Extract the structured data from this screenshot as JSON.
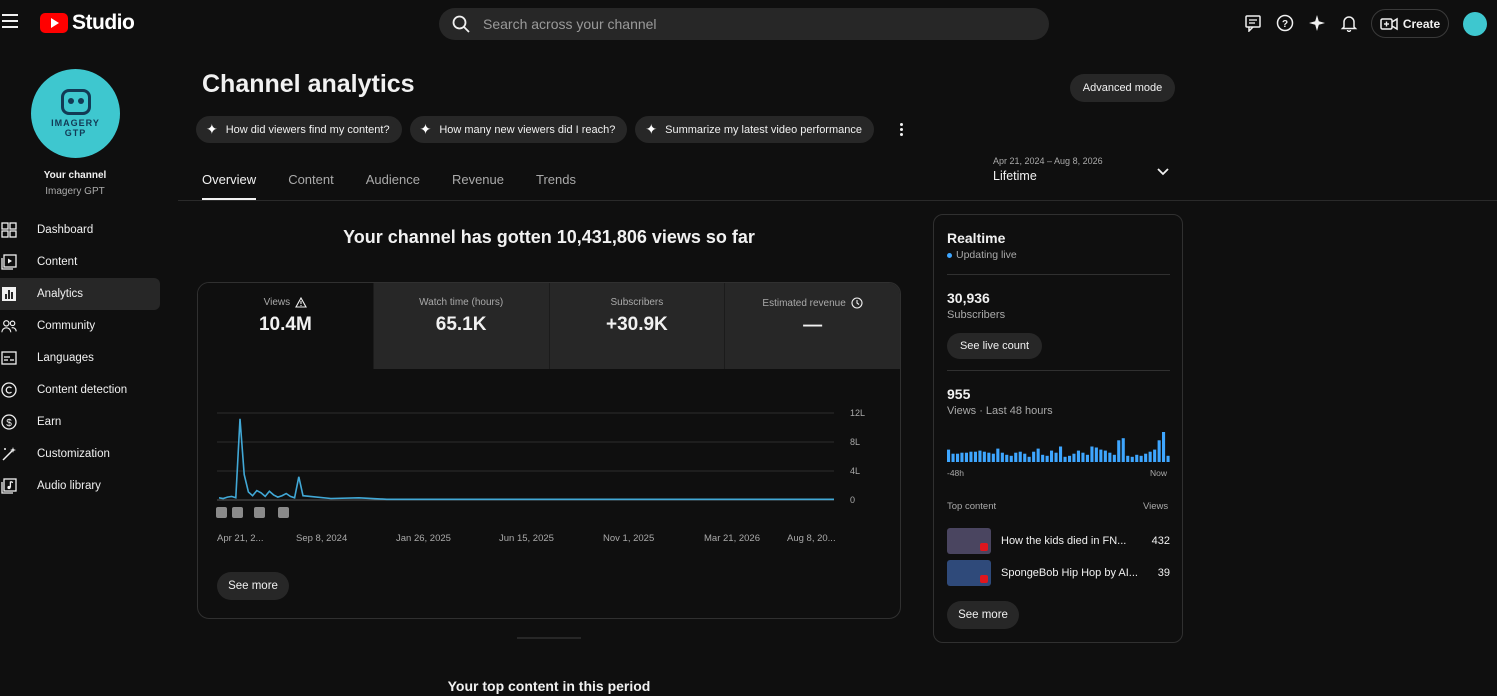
{
  "app": {
    "name": "Studio",
    "brand_color": "#ff0000",
    "accent": "#3ea6ff"
  },
  "search": {
    "placeholder": "Search across your channel"
  },
  "topbar": {
    "icons": [
      "feedback-icon",
      "help-icon",
      "sparkle-icon",
      "bell-icon"
    ],
    "create_label": "Create"
  },
  "channel": {
    "avatar_text_line1": "IMAGERY",
    "avatar_text_line2": "GTP",
    "label": "Your channel",
    "name": "Imagery GPT"
  },
  "sidebar": {
    "items": [
      {
        "label": "Dashboard",
        "icon": "dashboard-icon",
        "active": false
      },
      {
        "label": "Content",
        "icon": "content-icon",
        "active": false
      },
      {
        "label": "Analytics",
        "icon": "analytics-icon",
        "active": true
      },
      {
        "label": "Community",
        "icon": "community-icon",
        "active": false
      },
      {
        "label": "Languages",
        "icon": "languages-icon",
        "active": false
      },
      {
        "label": "Content detection",
        "icon": "copyright-icon",
        "active": false
      },
      {
        "label": "Earn",
        "icon": "earn-icon",
        "active": false
      },
      {
        "label": "Customization",
        "icon": "customization-icon",
        "active": false
      },
      {
        "label": "Audio library",
        "icon": "audio-library-icon",
        "active": false
      }
    ]
  },
  "page": {
    "title": "Channel analytics",
    "advanced_mode": "Advanced mode",
    "chips": [
      "How did viewers find my content?",
      "How many new viewers did I reach?",
      "Summarize my latest video performance"
    ],
    "tabs": [
      "Overview",
      "Content",
      "Audience",
      "Revenue",
      "Trends"
    ],
    "active_tab": "Overview",
    "date_range": {
      "range": "Apr 21, 2024 – Aug 8, 2026",
      "label": "Lifetime"
    }
  },
  "overview": {
    "headline": "Your channel has gotten 10,431,806 views so far",
    "metrics": [
      {
        "label": "Views",
        "value": "10.4M",
        "icon": "warning-icon",
        "selected": true
      },
      {
        "label": "Watch time (hours)",
        "value": "65.1K",
        "selected": false
      },
      {
        "label": "Subscribers",
        "value": "+30.9K",
        "selected": false
      },
      {
        "label": "Estimated revenue",
        "value": "—",
        "icon": "clock-icon",
        "selected": false
      }
    ],
    "see_more": "See more",
    "top_content_title": "Your top content in this period"
  },
  "chart_data": {
    "type": "line",
    "series": [
      {
        "values": [
          0.3,
          0.2,
          0.4,
          0.5,
          0.3,
          11.2,
          3.5,
          1.1,
          0.6,
          1.3,
          1.0,
          0.5,
          1.2,
          0.7,
          0.4,
          0.6,
          0.9,
          0.5,
          0.3,
          3.2,
          0.6,
          0.2,
          0.3,
          0.1,
          0.1,
          0.1,
          0.1,
          0.1,
          0.1,
          0.1,
          0.1,
          0.1,
          0.1,
          0.1,
          0.1,
          0.1,
          0.1,
          0.1,
          0.1,
          0.1
        ]
      }
    ],
    "x_tick_labels": [
      "Apr 21, 2...",
      "Sep 8, 2024",
      "Jan 26, 2025",
      "Jun 15, 2025",
      "Nov 1, 2025",
      "Mar 21, 2026",
      "Aug 8, 20..."
    ],
    "y_tick_labels": [
      "12L",
      "8L",
      "4L",
      "0"
    ],
    "ylim": [
      0,
      12
    ],
    "grid": true,
    "line_color": "#41a8d6",
    "markers": [
      "▪",
      "▪",
      "▪",
      "▪"
    ]
  },
  "realtime": {
    "title": "Realtime",
    "status": "Updating live",
    "subscribers_value": "30,936",
    "subscribers_label": "Subscribers",
    "see_live_count": "See live count",
    "views_value": "955",
    "views_label": "Views · Last 48 hours",
    "bars": [
      12,
      8,
      8,
      9,
      9,
      10,
      10,
      11,
      10,
      9,
      8,
      13,
      9,
      7,
      6,
      9,
      10,
      8,
      5,
      10,
      13,
      7,
      6,
      11,
      9,
      15,
      5,
      6,
      8,
      11,
      9,
      7,
      15,
      14,
      12,
      11,
      9,
      7,
      21,
      23,
      6,
      5,
      7,
      6,
      8,
      10,
      12,
      21,
      29,
      6
    ],
    "bar_color": "#3ea6ff",
    "axis_start": "-48h",
    "axis_end": "Now",
    "top_content_header": "Top content",
    "views_header": "Views",
    "top_content": [
      {
        "title": "How the kids died in FN...",
        "views": "432"
      },
      {
        "title": "SpongeBob Hip Hop by AI...",
        "views": "39"
      }
    ],
    "see_more": "See more"
  }
}
